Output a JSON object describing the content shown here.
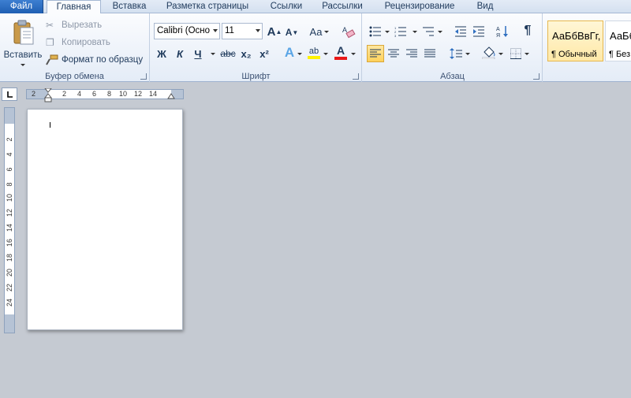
{
  "tabs": [
    {
      "label": "Файл"
    },
    {
      "label": "Главная"
    },
    {
      "label": "Вставка"
    },
    {
      "label": "Разметка страницы"
    },
    {
      "label": "Ссылки"
    },
    {
      "label": "Рассылки"
    },
    {
      "label": "Рецензирование"
    },
    {
      "label": "Вид"
    }
  ],
  "clipboard": {
    "paste_label": "Вставить",
    "cut_label": "Вырезать",
    "copy_label": "Копировать",
    "format_painter_label": "Формат по образцу",
    "group_label": "Буфер обмена"
  },
  "font": {
    "font_name": "Calibri (Осно",
    "font_size": "11",
    "grow_label": "A",
    "shrink_label": "A",
    "change_case_label": "Aa",
    "bold_label": "Ж",
    "italic_label": "К",
    "underline_label": "Ч",
    "strike_label": "abc",
    "subscript_label": "x₂",
    "superscript_label": "x²",
    "text_effects_label": "A",
    "highlight_label": "ab",
    "font_color_label": "A",
    "group_label": "Шрифт",
    "font_color": "#e81818",
    "highlight_color": "#fff200"
  },
  "paragraph": {
    "pilcrow_label": "¶",
    "group_label": "Абзац"
  },
  "styles": [
    {
      "sample": "АаБбВвГг,",
      "name": "¶ Обычный"
    },
    {
      "sample": "АаБбВвГг,",
      "name": "¶ Без ..."
    }
  ],
  "ruler": {
    "h_numbers": [
      "2",
      "2",
      "4",
      "6",
      "8",
      "10",
      "12",
      "14"
    ],
    "v_numbers": [
      "2",
      "4",
      "6",
      "8",
      "10",
      "12",
      "14",
      "16",
      "18",
      "20",
      "22",
      "24"
    ]
  }
}
